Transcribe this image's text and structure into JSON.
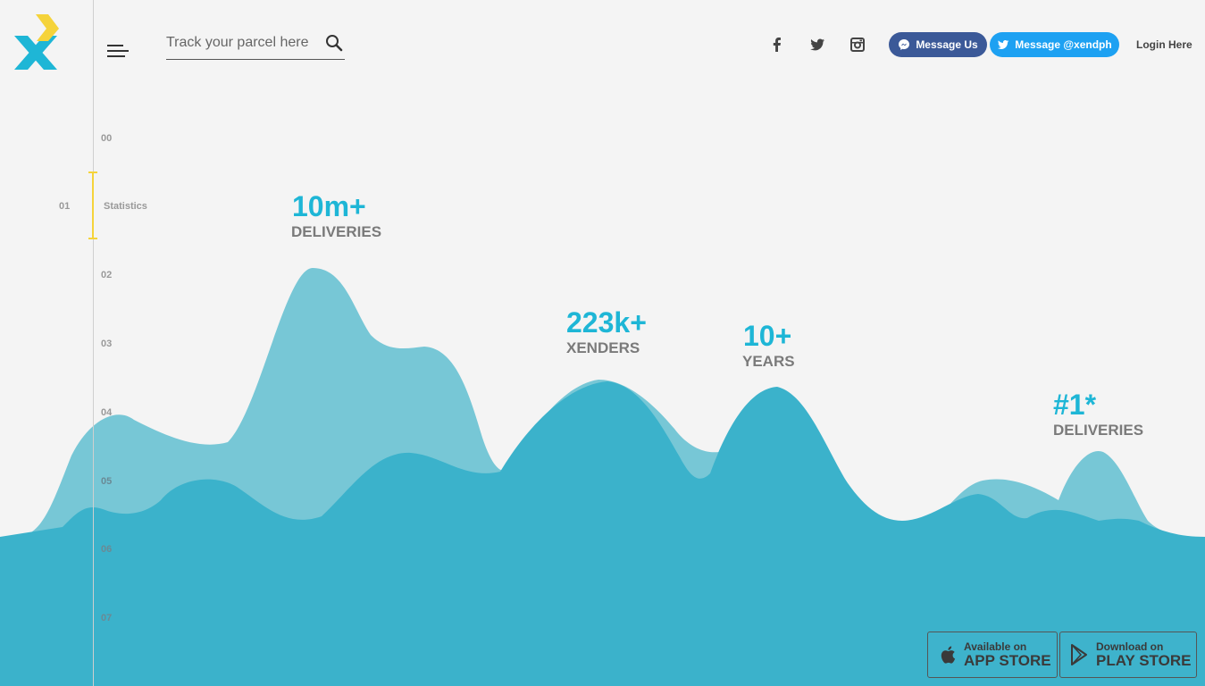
{
  "header": {
    "search": {
      "placeholder": "Track your parcel here"
    },
    "social": [
      "facebook-icon",
      "twitter-icon",
      "instagram-icon"
    ],
    "messenger_button": "Message Us",
    "twitter_button": "Message @xendph",
    "login": "Login Here"
  },
  "colors": {
    "accent": "#1eb6d6",
    "wave_light": "#77c7d6",
    "wave_dark": "#3bb2cb",
    "brand_yellow": "#f5d33a",
    "messenger": "#3b5998",
    "twitter": "#1da1f2"
  },
  "section_nav": {
    "items": [
      "00",
      "01",
      "02",
      "03",
      "04",
      "05",
      "06",
      "07"
    ],
    "active_label": "Statistics"
  },
  "stats": [
    {
      "value": "10m+",
      "label": "DELIVERIES"
    },
    {
      "value": "223k+",
      "label": "XENDERS"
    },
    {
      "value": "10+",
      "label": "YEARS"
    },
    {
      "value": "#1*",
      "label": "DELIVERIES"
    }
  ],
  "stores": {
    "app": {
      "top": "Available on",
      "main": "APP STORE"
    },
    "play": {
      "top": "Download on",
      "main": "PLAY STORE"
    }
  }
}
